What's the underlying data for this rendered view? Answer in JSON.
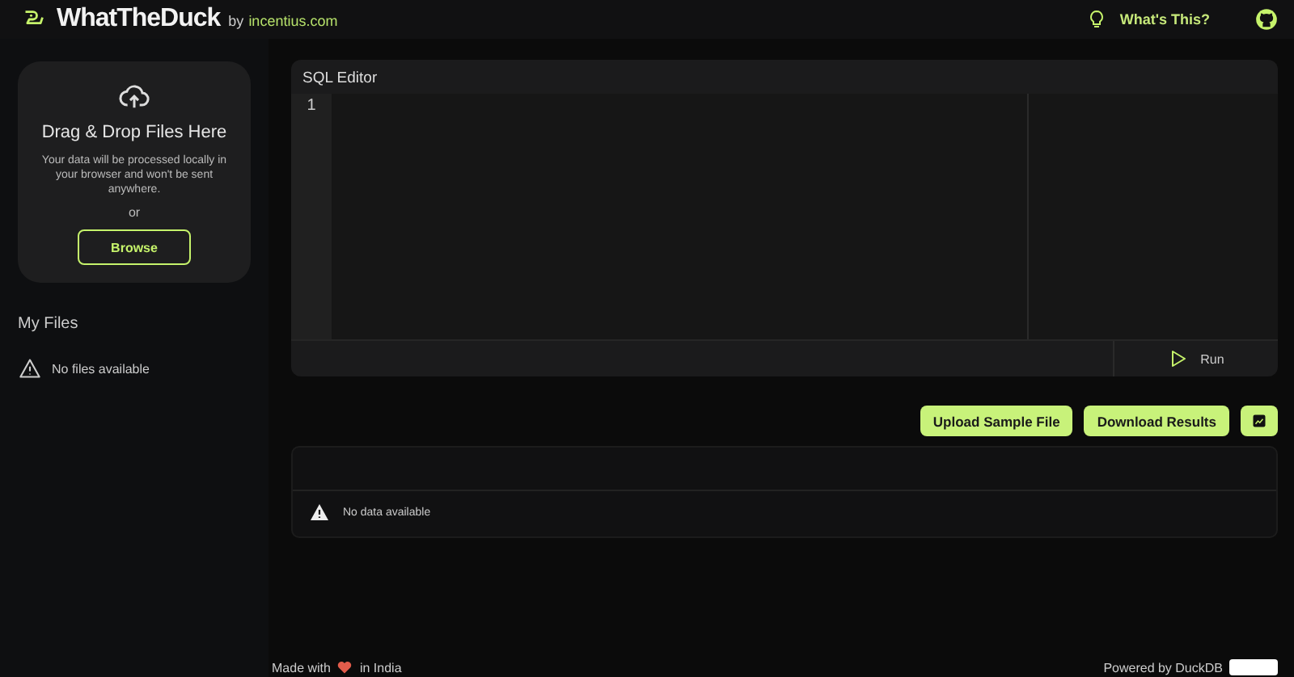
{
  "header": {
    "brand": "WhatTheDuck",
    "byline_prefix": "by",
    "byline_link": "incentius.com",
    "help_link": "What's This?"
  },
  "upload_card": {
    "title": "Drag & Drop Files Here",
    "description": "Your data will be processed locally in your browser and won't be sent anywhere.",
    "separator": "or",
    "button": "Browse"
  },
  "files": {
    "heading": "My Files",
    "empty_message": "No files available"
  },
  "editor": {
    "title": "SQL Editor",
    "line_numbers": [
      "1"
    ],
    "run_button": "Run"
  },
  "actions": [
    "Upload Sample File",
    "Download Results"
  ],
  "results": {
    "empty_message": "No data available"
  },
  "footer": {
    "made_prefix": "Made with",
    "made_suffix": "in India",
    "powered": "Powered by DuckDB"
  }
}
